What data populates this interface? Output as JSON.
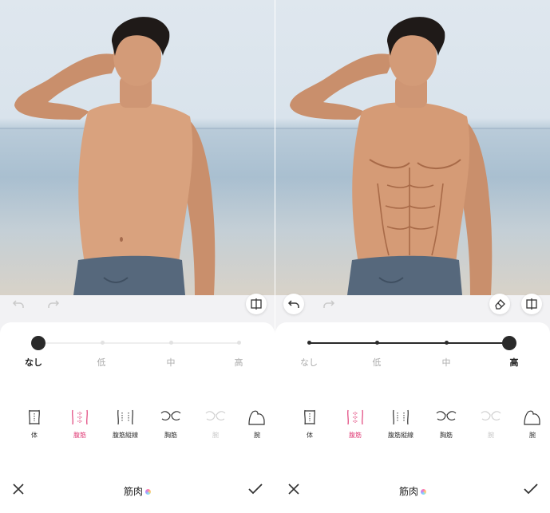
{
  "left": {
    "levels": [
      "なし",
      "低",
      "中",
      "高"
    ],
    "selected_level": "なし",
    "tools": [
      {
        "label": "体",
        "state": "normal"
      },
      {
        "label": "腹筋",
        "state": "active"
      },
      {
        "label": "腹筋縦線",
        "state": "normal"
      },
      {
        "label": "胸筋",
        "state": "normal"
      },
      {
        "label": "腕",
        "state": "disabled"
      },
      {
        "label": "腕",
        "state": "normal"
      }
    ],
    "title": "筋肉"
  },
  "right": {
    "levels": [
      "なし",
      "低",
      "中",
      "高"
    ],
    "selected_level": "高",
    "tools": [
      {
        "label": "体",
        "state": "normal"
      },
      {
        "label": "腹筋",
        "state": "active"
      },
      {
        "label": "腹筋縦線",
        "state": "normal"
      },
      {
        "label": "胸筋",
        "state": "normal"
      },
      {
        "label": "腕",
        "state": "disabled"
      },
      {
        "label": "腕",
        "state": "normal"
      }
    ],
    "title": "筋肉"
  },
  "colors": {
    "accent": "#e0417a",
    "knob": "#2a2a2a",
    "panel_bg": "#f2f2f4",
    "skin": "#d9a27e"
  },
  "icons": {
    "undo": "undo-icon",
    "redo": "redo-icon",
    "compare": "compare-icon",
    "eraser": "eraser-icon",
    "close": "close-icon",
    "confirm": "check-icon"
  }
}
